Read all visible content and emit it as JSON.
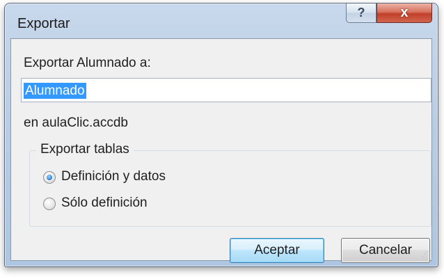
{
  "window": {
    "title": "Exportar",
    "help_label": "?",
    "close_label": "x"
  },
  "dialog": {
    "export_label": "Exportar Alumnado a:",
    "name_value": "Alumnado",
    "location_text": "en aulaClic.accdb",
    "group_title": "Exportar tablas",
    "options": [
      {
        "label": "Definición y datos",
        "selected": true
      },
      {
        "label": "Sólo definición",
        "selected": false
      }
    ],
    "ok_label": "Aceptar",
    "cancel_label": "Cancelar"
  },
  "colors": {
    "selection": "#3399ff",
    "close_red": "#c2402a",
    "dialog_bg": "#f0f0f0"
  }
}
